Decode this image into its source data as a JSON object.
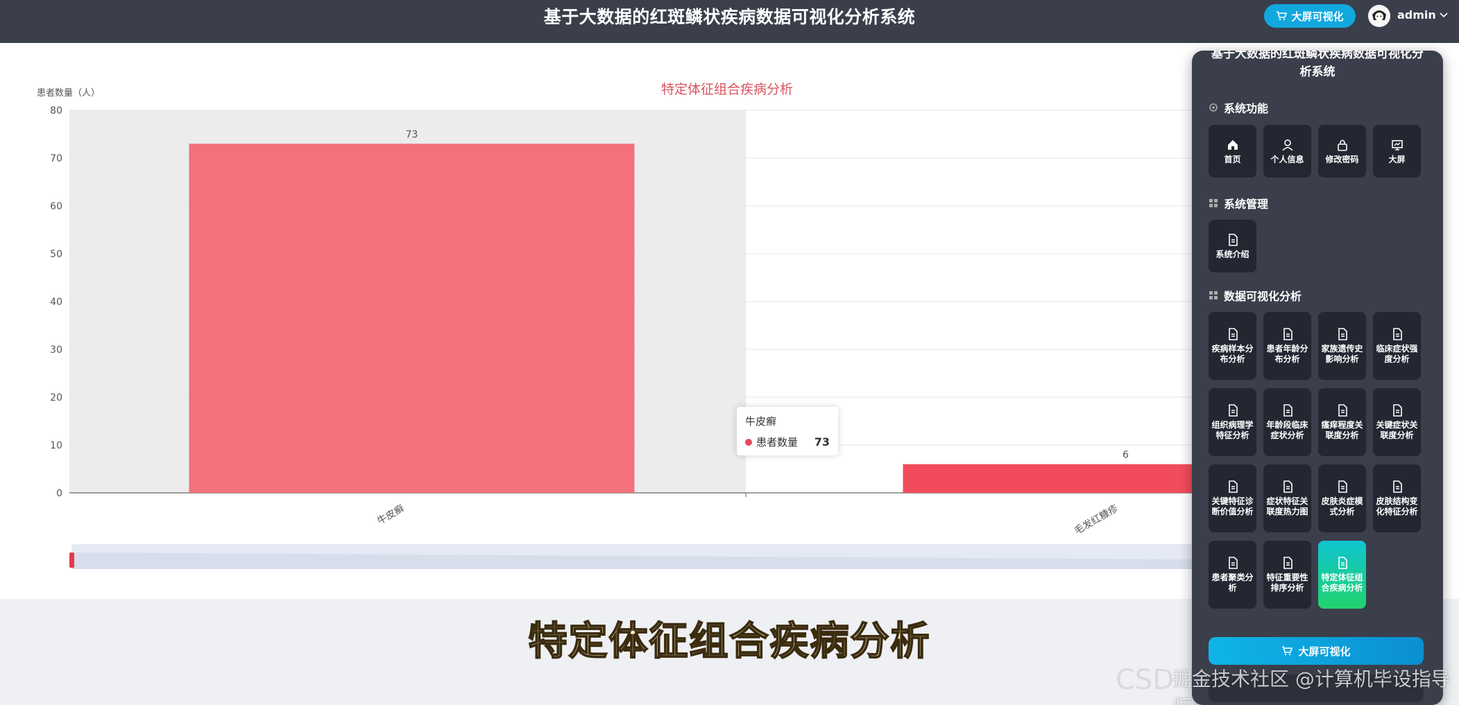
{
  "header": {
    "title": "基于大数据的红斑鳞状疾病数据可视化分析系统",
    "big_screen_btn": "大屏可视化",
    "user": "admin"
  },
  "chart_data": {
    "type": "bar",
    "title": "特定体征组合疾病分析",
    "ylabel": "患者数量（人）",
    "ylim": [
      0,
      80
    ],
    "yticks": [
      0,
      10,
      20,
      30,
      40,
      50,
      60,
      70,
      80
    ],
    "categories": [
      "牛皮癣",
      "毛发红糠疹"
    ],
    "series": [
      {
        "name": "患者数量",
        "values": [
          73,
          6
        ]
      }
    ],
    "colors": [
      "#f2717d",
      "#f24c5c"
    ],
    "grid": true,
    "hover_category": "牛皮癣"
  },
  "tooltip": {
    "category": "牛皮癣",
    "series": "患者数量",
    "value": "73"
  },
  "caption": "特定体征组合疾病分析",
  "watermark": {
    "left": "CSD",
    "right": "掘金技术社区 @计算机毕设指导师"
  },
  "side": {
    "title": "基于大数据的红斑鳞状疾病数据可视化分析系统",
    "sections": [
      {
        "title": "系统功能",
        "items": [
          "首页",
          "个人信息",
          "修改密码",
          "大屏"
        ]
      },
      {
        "title": "系统管理",
        "items": [
          "系统介绍"
        ]
      },
      {
        "title": "数据可视化分析",
        "items": [
          "疾病样本分布分析",
          "患者年龄分布分析",
          "家族遗传史影响分析",
          "临床症状强度分析",
          "组织病理学特征分析",
          "年龄段临床症状分析",
          "瘙痒程度关联度分析",
          "关键症状关联度分析",
          "关键特征诊断价值分析",
          "症状特征关联度热力图",
          "皮肤炎症模式分析",
          "皮肤结构变化特征分析",
          "患者聚类分析",
          "特征重要性排序分析",
          "特定体征组合疾病分析"
        ]
      }
    ],
    "big_screen_btn": "大屏可视化"
  }
}
